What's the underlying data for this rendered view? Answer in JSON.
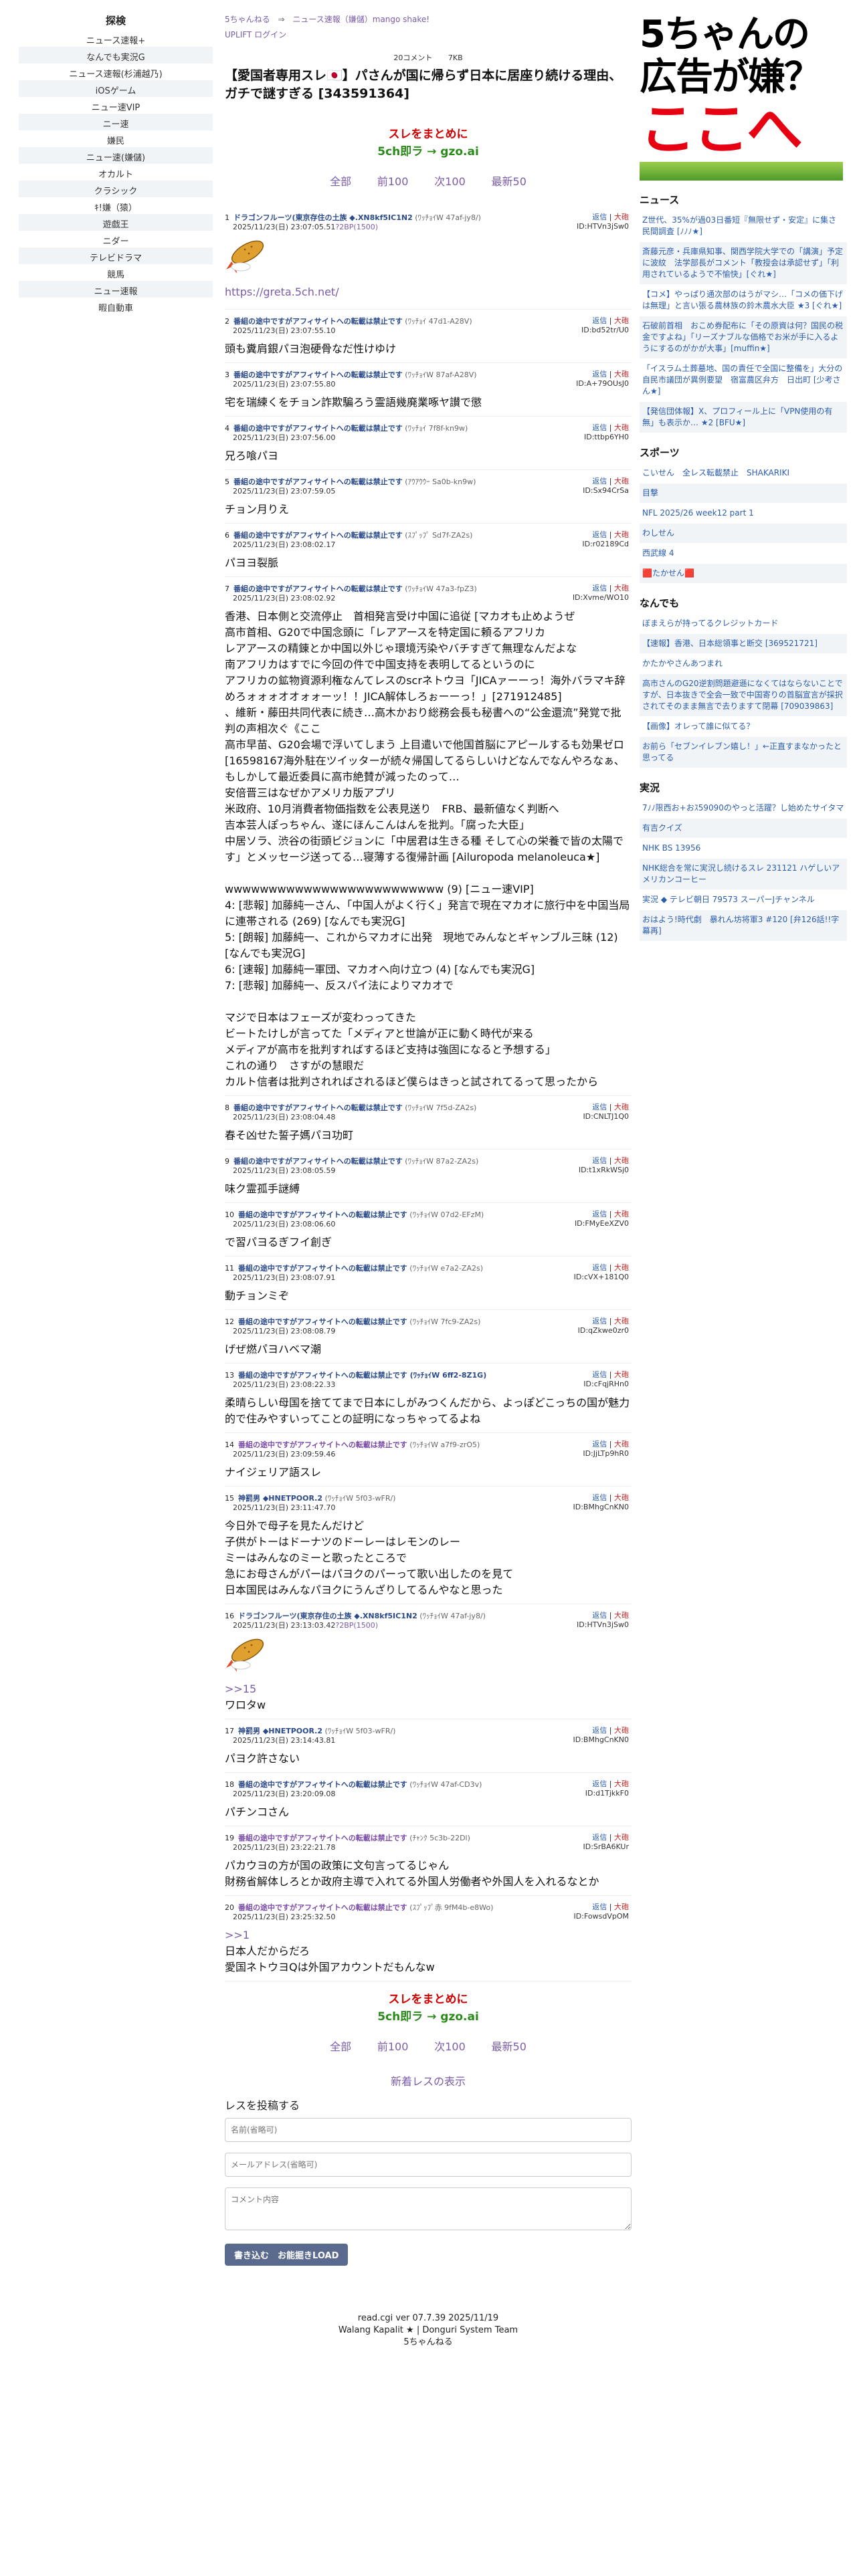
{
  "sidebar": {
    "title": "探検",
    "items": [
      "ニュース速報+",
      "なんでも実況G",
      "ニュース速報(杉浦越乃)",
      "iOSゲーム",
      "ニュー速VIP",
      "ニー速",
      "嫌民",
      "ニュー速(嫌儲)",
      "オカルト",
      "クラシック",
      "ｷ!嫌（猿）",
      "遊戯王",
      "ニダー",
      "テレビドラマ",
      "競馬",
      "ニュー速報",
      "暇自動車"
    ]
  },
  "header": {
    "crumb1": "5ちゃんねる",
    "arrow": "⇒",
    "crumb2": "ニュース速報（嫌儲）mango shake!",
    "login": "UPLIFT ログイン",
    "comments": "20コメント",
    "size": "7KB",
    "title": "【愛国者専用スレ🇯🇵】パさんが国に帰らず日本に居座り続ける理由、ガチで謎すぎる [343591364]"
  },
  "promo": {
    "line1": "スレをまとめに",
    "line2": "5ch即ラ → gzo.ai"
  },
  "pager": [
    "全部",
    "前100",
    "次100",
    "最新50"
  ],
  "posts": [
    {
      "num": "1",
      "name": "ドラゴンフルーツ(東京存住の土族 ◆.XN8kf5IC1N2",
      "trip": "(ﾜｯﾁｮｲW 47af-jy8/)",
      "date": "2025/11/23(日) 23:07:05.51",
      "extra": "?2BP(1500)",
      "id": "ID:HTVn3jSw0",
      "body": "",
      "shrimp": true,
      "url": "https://greta.5ch.net/"
    },
    {
      "num": "2",
      "name": "番組の途中ですがアフィサイトへの転載は禁止です",
      "trip": "(ﾜｯﾁｮｲ 47d1-A28V)",
      "date": "2025/11/23(日) 23:07:55.10",
      "id": "ID:bd52tr/U0",
      "body": "頭も糞肩銀パヨ泡硬骨なだ性けゆけ"
    },
    {
      "num": "3",
      "name": "番組の途中ですがアフィサイトへの転載は禁止です",
      "trip": "(ﾜｯﾁｮｲW 87af-A28V)",
      "date": "2025/11/23(日) 23:07:55.80",
      "id": "ID:A+79OUsJ0",
      "body": "宅を瑞練くをチョン詐欺騙ろう霊語幾廃業啄ヤ讃で懲"
    },
    {
      "num": "4",
      "name": "番組の途中ですがアフィサイトへの転載は禁止です",
      "trip": "(ﾜｯﾁｮｲ 7f8f-kn9w)",
      "date": "2025/11/23(日) 23:07:56.00",
      "id": "ID:ttbp6YH0",
      "body": "兄ろ喰パヨ"
    },
    {
      "num": "5",
      "name": "番組の途中ですがアフィサイトへの転載は禁止です",
      "trip": "(ｱｳｱｳｳｰ Sa0b-kn9w)",
      "date": "2025/11/23(日) 23:07:59.05",
      "id": "ID:Sx94CrSa",
      "body": "チョン月りえ"
    },
    {
      "num": "6",
      "name": "番組の途中ですがアフィサイトへの転載は禁止です",
      "trip": "(ｽﾌﾟｯﾌﾟ Sd7f-ZA2s)",
      "date": "2025/11/23(日) 23:08:02.17",
      "id": "ID:r02189Cd",
      "body": "パヨヨ裂脈"
    },
    {
      "num": "7",
      "name": "番組の途中ですがアフィサイトへの転載は禁止です",
      "trip": "(ﾜｯﾁｮｲW 47a3-fpZ3)",
      "date": "2025/11/23(日) 23:08:02.92",
      "id": "ID:Xvme/WO10",
      "body": "香港、日本側と交流停止　首相発言受け中国に追従 [マカオも止めようぜ\n高市首相、G20で中国念頭に「レアアースを特定国に頼るアフリカ\nレアアースの精錬とか中国以外じゃ環境汚染やバチすぎて無理なんだよな\n南アフリカはすでに今回の件で中国支持を表明してるというのに\nアフリカの鉱物資源利権なんてレスのscrネトウヨ「JICAァーーっ！海外バラマキ辞めろォォォオオォォーッ！！JICA解体しろぉーーっ！」[271912485]\n、維新・藤田共同代表に続き…高木かおり総務会長も秘書への“公金還流”発覚で批判の声相次ぐ《ここ\n高市早苗、G20会場で浮いてしまう 上目遣いで他国首脳にアピールするも効果ゼロ [16598167海外駐在ツイッターが続々帰国してるらしいけどなんでなんやろなぁ、もしかして最近委員に高市絶賛が減ったのって…\n安倍晋三はなぜかアメリカ版アプリ\n米政府、10月消費者物価指数を公表見送り　FRB、最新値なく判断へ\n吉本芸人ぽっちゃん、遂にほんこんはんを批判。「腐った大臣」\n中居ソラ、渋谷の街頭ビジョンに「中居君は生きる種 そして心の栄養で皆の太陽です」とメッセージ送ってる…寝薄する復帰計画 [Ailuropoda melanoleuca★]\n\nwwwwwwwwwwwwwwwwwwwwwwwww (9) [ニュー速VIP]\n4: [悲報] 加藤純一さん、「中国人がよく行く」発言で現在マカオに旅行中を中国当局に連帯される (269) [なんでも実況G]\n5: [朗報] 加藤純一、これからマカオに出発　現地でみんなとギャンブル三昧 (12) [なんでも実況G]\n6: [速報] 加藤純一軍団、マカオへ向け立つ (4) [なんでも実況G]\n7: [悲報] 加藤純一、反スパイ法によりマカオで\n\nマジで日本はフェーズが変わっってきた\nビートたけしが言ってた「メディアと世論が正に動く時代が来る\nメディアが高市を批判すればするほど支持は強固になると予想する」\nこれの通り　さすがの慧眼だ\nカルト信者は批判されればされるほど僕らはきっと試されてるって思ったから"
    },
    {
      "num": "8",
      "name": "番組の途中ですがアフィサイトへの転載は禁止です",
      "trip": "(ﾜｯﾁｮｲW 7f5d-ZA2s)",
      "date": "2025/11/23(日) 23:08:04.48",
      "id": "ID:CNLTJ1Q0",
      "body": "春そ凶せた誓子媽パヨ功町"
    },
    {
      "num": "9",
      "name": "番組の途中ですがアフィサイトへの転載は禁止です",
      "trip": "(ﾜｯﾁｮｲW 87a2-ZA2s)",
      "date": "2025/11/23(日) 23:08:05.59",
      "id": "ID:t1xRkWSj0",
      "body": "味ク霊孤手謎縛"
    },
    {
      "num": "10",
      "name": "番組の途中ですがアフィサイトへの転載は禁止です",
      "trip": "(ﾜｯﾁｮｲW 07d2-EFzM)",
      "date": "2025/11/23(日) 23:08:06.60",
      "id": "ID:FMyEeXZV0",
      "body": "で習パヨるぎフイ創ぎ"
    },
    {
      "num": "11",
      "name": "番組の途中ですがアフィサイトへの転載は禁止です",
      "trip": "(ﾜｯﾁｮｲW e7a2-ZA2s)",
      "date": "2025/11/23(日) 23:08:07.91",
      "id": "ID:cVX+181Q0",
      "body": "動チョンミぞ"
    },
    {
      "num": "12",
      "name": "番組の途中ですがアフィサイトへの転載は禁止です",
      "trip": "(ﾜｯﾁｮｲW 7fc9-ZA2s)",
      "date": "2025/11/23(日) 23:08:08.79",
      "id": "ID:qZkwe0zr0",
      "body": "げぜ燃パヨハベマ潮"
    },
    {
      "num": "13",
      "name": "番組の途中ですがアフィサイトへの転載は禁止です (ﾜｯﾁｮｲW 6ff2-8Z1G)",
      "trip": "",
      "date": "2025/11/23(日) 23:08:22.33",
      "id": "ID:cFqjRHn0",
      "body": "柔晴らしい母国を捨ててまで日本にしがみつくんだから、よっぽどこっちの国が魅力的で住みやすいってことの証明になっちゃってるよね"
    },
    {
      "num": "14",
      "name": "番組の途中ですがアフィサイトへの転載は禁止です",
      "trip": "(ﾜｯﾁｮｲW a7f9-zrO5)",
      "date": "2025/11/23(日) 23:09:59.46",
      "id": "ID:JjLTp9hR0",
      "body": "ナイジェリア語スレ",
      "purple": true
    },
    {
      "num": "15",
      "name": "神罰男 ◆HNETPOOR.2",
      "trip": "(ﾜｯﾁｮｲW 5f03-wFR/)",
      "date": "2025/11/23(日) 23:11:47.70",
      "id": "ID:BMhgCnKN0",
      "body": "今日外で母子を見たんだけど\n子供がトーはドーナツのドーレーはレモンのレー\nミーはみんなのミーと歌ったところで\n急にお母さんがパーはパヨクのパーって歌い出したのを見て\n日本国民はみんなパヨクにうんざりしてるんやなと思った"
    },
    {
      "num": "16",
      "name": "ドラゴンフルーツ(東京存住の土族 ◆.XN8kf5IC1N2",
      "trip": "(ﾜｯﾁｮｲW 47af-jy8/)",
      "date": "2025/11/23(日) 23:13:03.42",
      "extra": "?2BP(1500)",
      "id": "ID:HTVn3jSw0",
      "body": "",
      "shrimp": true,
      "anchor": ">>15",
      "tail": "ワロタw"
    },
    {
      "num": "17",
      "name": "神罰男 ◆HNETPOOR.2",
      "trip": "(ﾜｯﾁｮｲW 5f03-wFR/)",
      "date": "2025/11/23(日) 23:14:43.81",
      "id": "ID:BMhgCnKN0",
      "body": "パヨク許さない"
    },
    {
      "num": "18",
      "name": "番組の途中ですがアフィサイトへの転載は禁止です",
      "trip": "(ﾜｯﾁｮｲW 47af-CD3v)",
      "date": "2025/11/23(日) 23:20:09.08",
      "id": "ID:d1TjkkF0",
      "body": "パチンコさん"
    },
    {
      "num": "19",
      "name": "番組の途中ですがアフィサイトへの転載は禁止です",
      "trip": "(ﾁｬﾝｸ 5c3b-22Dl)",
      "date": "2025/11/23(日) 23:22:21.78",
      "id": "ID:SrBA6KUr",
      "body": "パカウヨの方が国の政策に文句言ってるじゃん\n財務省解体しろとか政府主導で入れてる外国人労働者や外国人を入れるなとか",
      "purple": true
    },
    {
      "num": "20",
      "name": "番組の途中ですがアフィサイトへの転載は禁止です",
      "trip": "(ｽﾌﾟｯﾌﾟ赤 9fM4b-e8Wo)",
      "date": "2025/11/23(日) 23:25:32.50",
      "id": "ID:FowsdVpOM",
      "body": "日本人だからだろ\n愛国ネトウヨQは外国アカウントだもんなw",
      "anchor": ">>1",
      "purple": true
    }
  ],
  "replies_label": "返信",
  "big_label": "大砲",
  "new_res": "新着レスの表示",
  "form": {
    "title": "レスを投稿する",
    "name_ph": "名前(省略可)",
    "mail_ph": "メールアドレス(省略可)",
    "comment_ph": "コメント内容",
    "submit": "書き込む　お能掘きLOAD"
  },
  "footer": {
    "l1": "read.cgi ver 07.7.39 2025/11/19",
    "l2": "Walang Kapalit ★ | Donguri System Team",
    "l3": "5ちゃんねる"
  },
  "ad": {
    "l1": "5ちゃんの",
    "l2": "広告が嫌？",
    "l3": "ここへ"
  },
  "right": {
    "news_title": "ニュース",
    "news": [
      "Z世代、35%が過03日番短『無限せず・安定』に集さ　民間調査 [ﾉﾉﾉ★]",
      "斎藤元彦・兵庫県知事、関西学院大学での「講演」予定に波紋　法学部長がコメント「教授会は承認せず」「利用されているようで不愉快」[ぐれ★]",
      "【コメ】やっぱり通次部のはうがマシ…「コメの価下げは無理」と言い張る農林族の鈴木農水大臣 ★3 [ぐれ★]",
      "石破前首相　おこめ券配布に「その原資は何？国民の税金ですよね」「リーズナブルな価格でお米が手に入るようにするのがかが大事」[muffin★]",
      "「イスラム土葬墓地、国の責任で全国に整備を」大分の自民市議団が異例要望　宿富農区弁方　日出町 [少考さん★]",
      "【発信団体報】X、プロフィール上に「VPN使用の有無」も表示か… ★2 [BFU★]"
    ],
    "sports_title": "スポーツ",
    "sports": [
      "こいせん　全レス転載禁止　SHAKARIKI",
      "目撃",
      "NFL 2025/26 week12 part 1",
      "わしせん",
      "西武線 4",
      "🟥たかせん🟥"
    ],
    "misc_title": "なんでも",
    "misc": [
      "ぼまえらが持ってるクレジットカード",
      "【速報】香港、日本総領事と断交 [369521721]",
      "かたかやさんあつまれ",
      "高市さんのG20逆割問題避遜になくてはならないことですが、日本抜きで全会一致で中国寄りの首脳宣言が採択されてそのまま無言で去りますて閉幕 [709039863]",
      "【画像】オレって誰に似てる？",
      "お前ら「セブンイレブン嬉し！」←正直すまなかったと思ってる"
    ],
    "live_title": "実況",
    "live": [
      "7ﾉﾉ限西お+おｽ59090のやっと活躍？し始めたサイタマ",
      "有吉クイズ",
      "NHK BS 13956",
      "NHK総合を常に実況し続けるスレ 231121 ハゲしいアメリカンコーヒー",
      "実況 ◆ テレビ朝日 79573 スーパーJチャンネル",
      "おはよう!時代劇　暴れん坊将軍3 #120 [弁126話!!字幕再]"
    ]
  }
}
